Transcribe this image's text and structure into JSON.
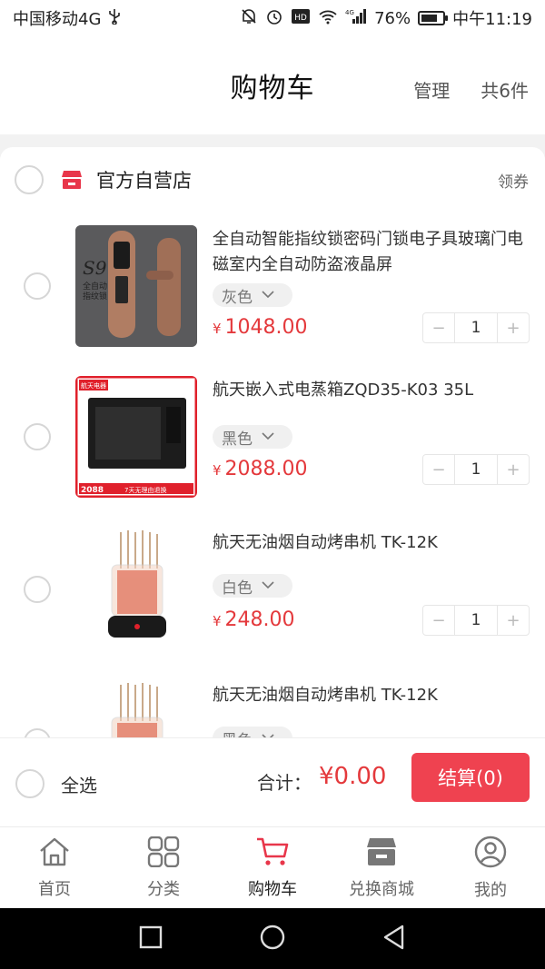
{
  "status_bar": {
    "carrier": "中国移动4G",
    "usb_icon": "usb-icon",
    "battery_percent": "76%",
    "battery_level": 0.76,
    "time": "中午11:19",
    "network": "4G"
  },
  "header": {
    "title": "购物车",
    "manage_label": "管理",
    "count_label": "共6件"
  },
  "store": {
    "name": "官方自营店",
    "coupon_label": "领券"
  },
  "items": [
    {
      "title": "全自动智能指纹锁密码门锁电子具玻璃门电磁室内全自动防盗液晶屏",
      "spec": "灰色",
      "currency": "¥",
      "price": "1048.00",
      "qty": "1",
      "thumb_text_a": "S9",
      "thumb_text_b": "全自动",
      "thumb_text_c": "指纹锁"
    },
    {
      "title": "航天嵌入式电蒸箱ZQD35-K03 35L",
      "spec": "黑色",
      "currency": "¥",
      "price": "2088.00",
      "qty": "1",
      "thumb_text_a": "航天电器",
      "thumb_text_b": "2088",
      "thumb_text_c": "7天无理由退换"
    },
    {
      "title": "航天无油烟自动烤串机 TK-12K",
      "spec": "白色",
      "currency": "¥",
      "price": "248.00",
      "qty": "1"
    },
    {
      "title": "航天无油烟自动烤串机 TK-12K",
      "spec": "黑色"
    }
  ],
  "action_bar": {
    "select_all_label": "全选",
    "total_label": "合计：",
    "total_value": "¥0.00",
    "checkout_label": "结算(0)"
  },
  "tabs": [
    {
      "label": "首页",
      "icon": "home-icon"
    },
    {
      "label": "分类",
      "icon": "category-icon"
    },
    {
      "label": "购物车",
      "icon": "cart-icon",
      "active": true
    },
    {
      "label": "兑换商城",
      "icon": "store-icon"
    },
    {
      "label": "我的",
      "icon": "user-icon"
    }
  ],
  "colors": {
    "accent": "#ef4250",
    "price": "#e4393c",
    "store_icon": "#e8364a"
  }
}
